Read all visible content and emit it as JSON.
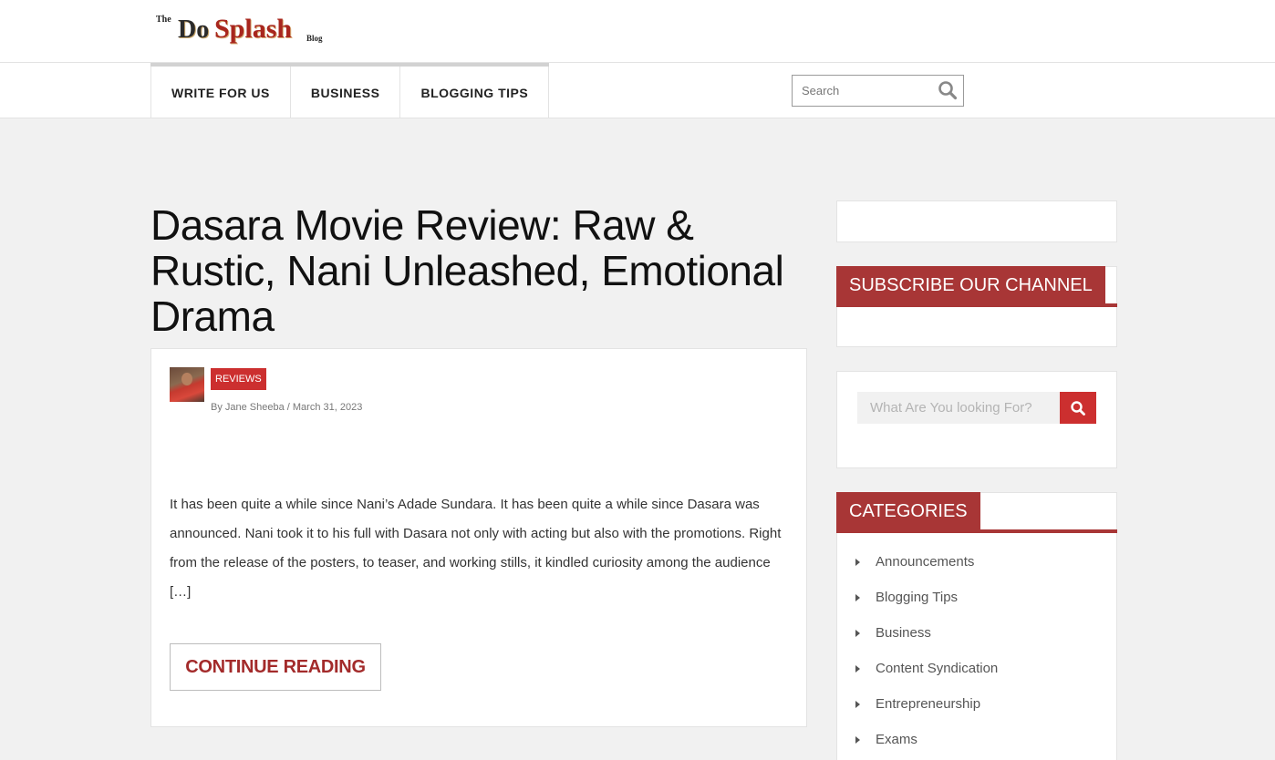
{
  "header": {
    "logo": {
      "the": "The",
      "do": "Do",
      "splash": "Splash",
      "blog": "Blog"
    }
  },
  "nav": {
    "items": [
      {
        "label": "WRITE FOR US"
      },
      {
        "label": "BUSINESS"
      },
      {
        "label": "BLOGGING TIPS"
      }
    ],
    "search_placeholder": "Search"
  },
  "post": {
    "title": "Dasara Movie Review: Raw & Rustic, Nani Unleashed, Emotional Drama",
    "category": "REVIEWS",
    "byline": "By Jane Sheeba / March 31, 2023",
    "excerpt": "It has been quite a while since Nani’s Adade Sundara. It has been quite a while since Dasara was announced. Nani took it to his full with Dasara not only with acting but also with the promotions. Right from the release of the posters, to teaser, and working stills, it kindled curiosity among the audience […]",
    "continue_label": "CONTINUE READING"
  },
  "sidebar": {
    "subscribe_title": "SUBSCRIBE OUR CHANNEL",
    "search_placeholder": "What Are You looking For?",
    "categories_title": "CATEGORIES",
    "categories": [
      {
        "label": "Announcements"
      },
      {
        "label": "Blogging Tips"
      },
      {
        "label": "Business"
      },
      {
        "label": "Content Syndication"
      },
      {
        "label": "Entrepreneurship"
      },
      {
        "label": "Exams"
      }
    ]
  },
  "colors": {
    "accent": "#a83636",
    "badge": "#cc2f2f",
    "link": "#a32b2b",
    "background": "#f1f1f1"
  },
  "icons": {
    "nav_search": "search-icon",
    "sidebar_search": "search-icon",
    "category_bullet": "caret-right-icon"
  }
}
